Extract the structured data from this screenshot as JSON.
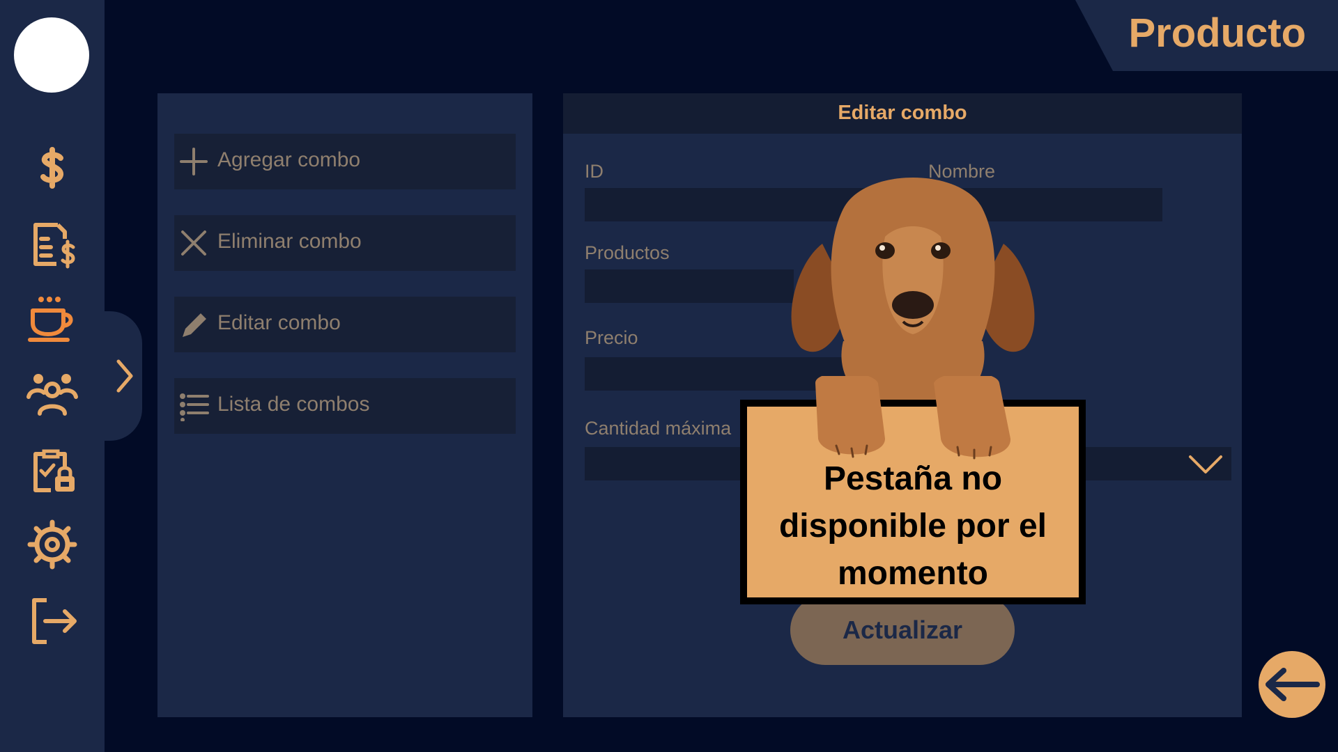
{
  "header": {
    "title": "Producto"
  },
  "sidebar": {
    "icons": [
      "dollar-icon",
      "invoice-icon",
      "coffee-cup-icon",
      "people-icon",
      "clipboard-lock-icon",
      "settings-gear-icon",
      "logout-icon"
    ],
    "active_icon": "coffee-cup-icon"
  },
  "actions": [
    {
      "label": "Agregar combo",
      "icon": "plus-icon"
    },
    {
      "label": "Eliminar combo",
      "icon": "x-icon"
    },
    {
      "label": "Editar combo",
      "icon": "pencil-icon"
    },
    {
      "label": "Lista de combos",
      "icon": "list-icon"
    }
  ],
  "form": {
    "title": "Editar combo",
    "id_label": "ID",
    "nombre_label": "Nombre",
    "productos_label": "Productos",
    "precio_label": "Precio",
    "cantidad_label": "Cantidad máxima",
    "submit_label": "Actualizar"
  },
  "overlay": {
    "message": "Pestaña no disponible por el momento"
  },
  "colors": {
    "accent": "#e6a967",
    "active_icon": "#f08a3c",
    "background": "#020b26",
    "panel": "#1b2847",
    "muted_text": "#8f7f6e"
  }
}
